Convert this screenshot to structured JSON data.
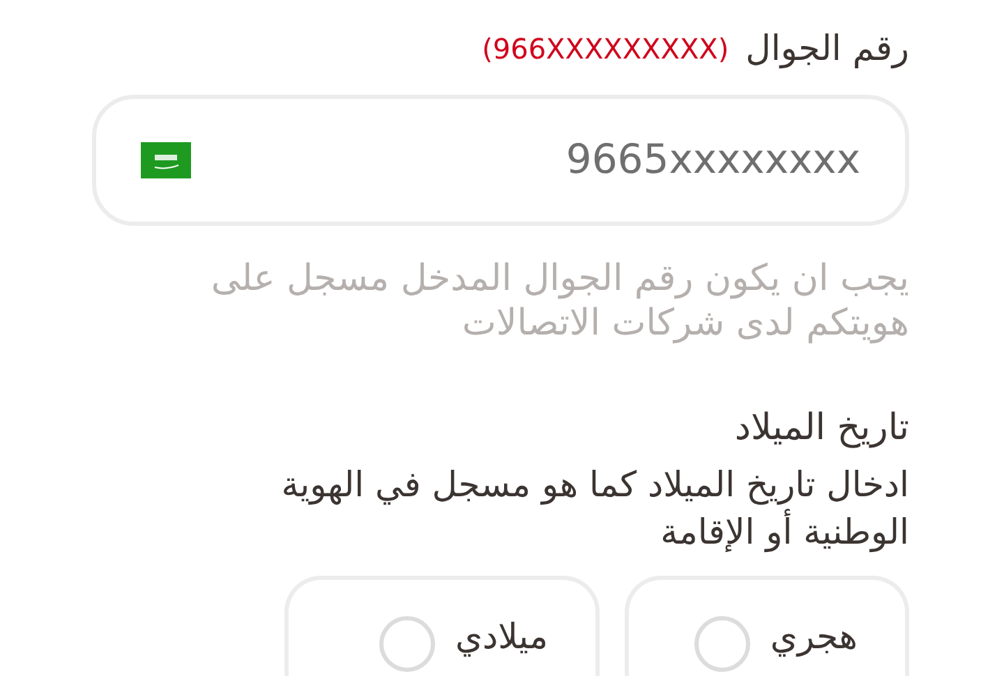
{
  "phone": {
    "label": "رقم الجوال",
    "format_hint": "(966XXXXXXXXX)",
    "placeholder": "9665xxxxxxxx",
    "note": "يجب ان يكون رقم الجوال المدخل مسجل على هويتكم لدى شركات الاتصالات"
  },
  "birth_date": {
    "title": "تاريخ الميلاد",
    "description": "ادخال تاريخ الميلاد كما هو مسجل في الهوية الوطنية أو الإقامة",
    "options": [
      {
        "label": "هجري",
        "selected": false
      },
      {
        "label": "ميلادي",
        "selected": false
      }
    ]
  }
}
